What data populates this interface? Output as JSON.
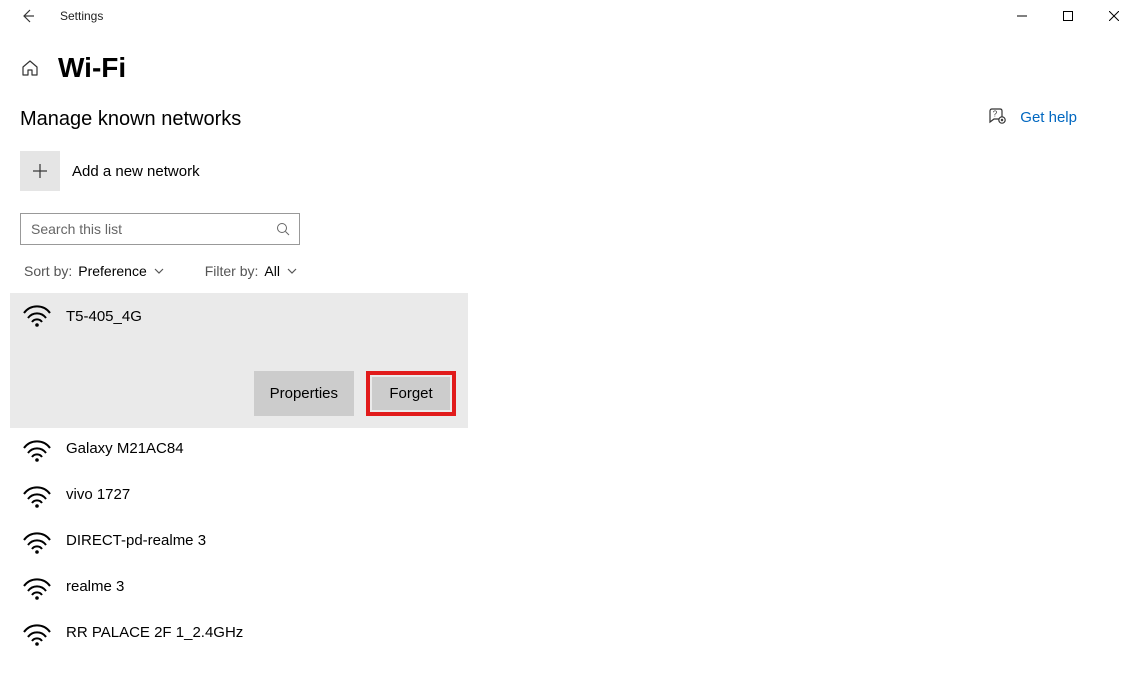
{
  "titlebar": {
    "title": "Settings"
  },
  "header": {
    "page_title": "Wi-Fi"
  },
  "section": {
    "title": "Manage known networks",
    "add_label": "Add a new network",
    "search_placeholder": "Search this list"
  },
  "filters": {
    "sort_label": "Sort by:",
    "sort_value": "Preference",
    "filter_label": "Filter by:",
    "filter_value": "All"
  },
  "selected_network": {
    "name": "T5-405_4G",
    "properties_label": "Properties",
    "forget_label": "Forget"
  },
  "networks": [
    {
      "name": "Galaxy M21AC84"
    },
    {
      "name": "vivo 1727"
    },
    {
      "name": "DIRECT-pd-realme 3"
    },
    {
      "name": "realme 3"
    },
    {
      "name": "RR PALACE 2F 1_2.4GHz"
    }
  ],
  "help": {
    "label": "Get help"
  }
}
